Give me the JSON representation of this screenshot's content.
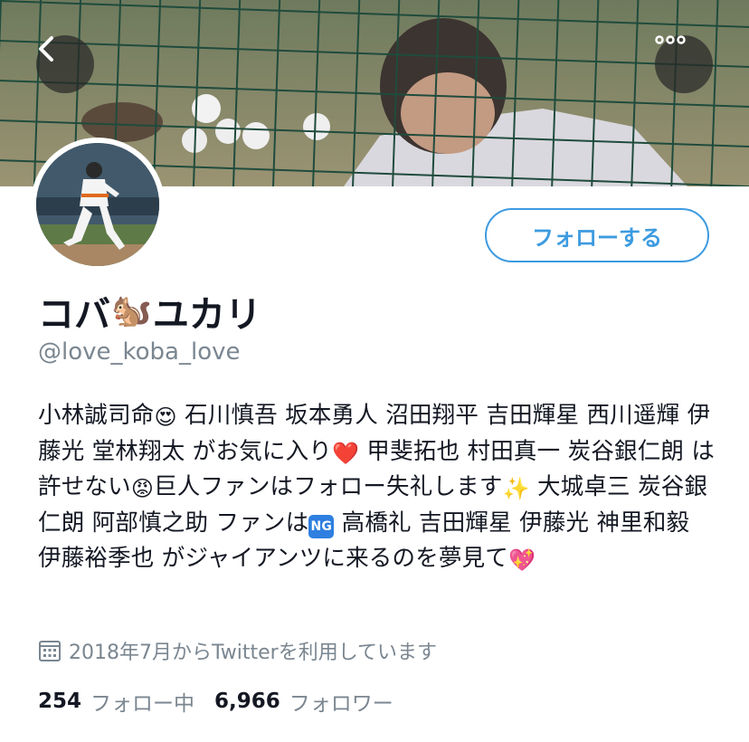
{
  "header": {
    "back_icon": "chevron-left-icon",
    "more_icon": "more-horizontal-icon"
  },
  "profile": {
    "name_part1": "コバ",
    "name_emoji": "🐿️",
    "name_part2": "ユカリ",
    "handle": "@love_koba_love",
    "follow_label": "フォローする",
    "bio": {
      "seg1": "小林誠司命",
      "emoji1": "😍",
      "seg2": " 石川慎吾 坂本勇人 沼田翔平 吉田輝星 西川遥輝 伊藤光 堂林翔太 がお気に入り",
      "emoji2": "❤️",
      "seg3": " 甲斐拓也 村田真一 炭谷銀仁朗 は許せない",
      "emoji3": "😡",
      "seg4": "巨人ファンはフォロー失礼します",
      "emoji4": "✨",
      "seg5": " 大城卓三 炭谷銀仁朗 阿部慎之助 ファンは",
      "ng_badge": "NG",
      "seg6": " 高橋礼 吉田輝星 伊藤光 神里和毅 伊藤裕季也 がジャイアンツに来るのを夢見て",
      "emoji5": "💖"
    },
    "joined_icon": "calendar-icon",
    "joined": "2018年7月からTwitterを利用しています",
    "following_count": "254",
    "following_label": "フォロー中",
    "followers_count": "6,966",
    "followers_label": "フォロワー"
  },
  "colors": {
    "accent": "#3d9be0",
    "text": "#141823",
    "secondary_text": "#7a8690"
  }
}
